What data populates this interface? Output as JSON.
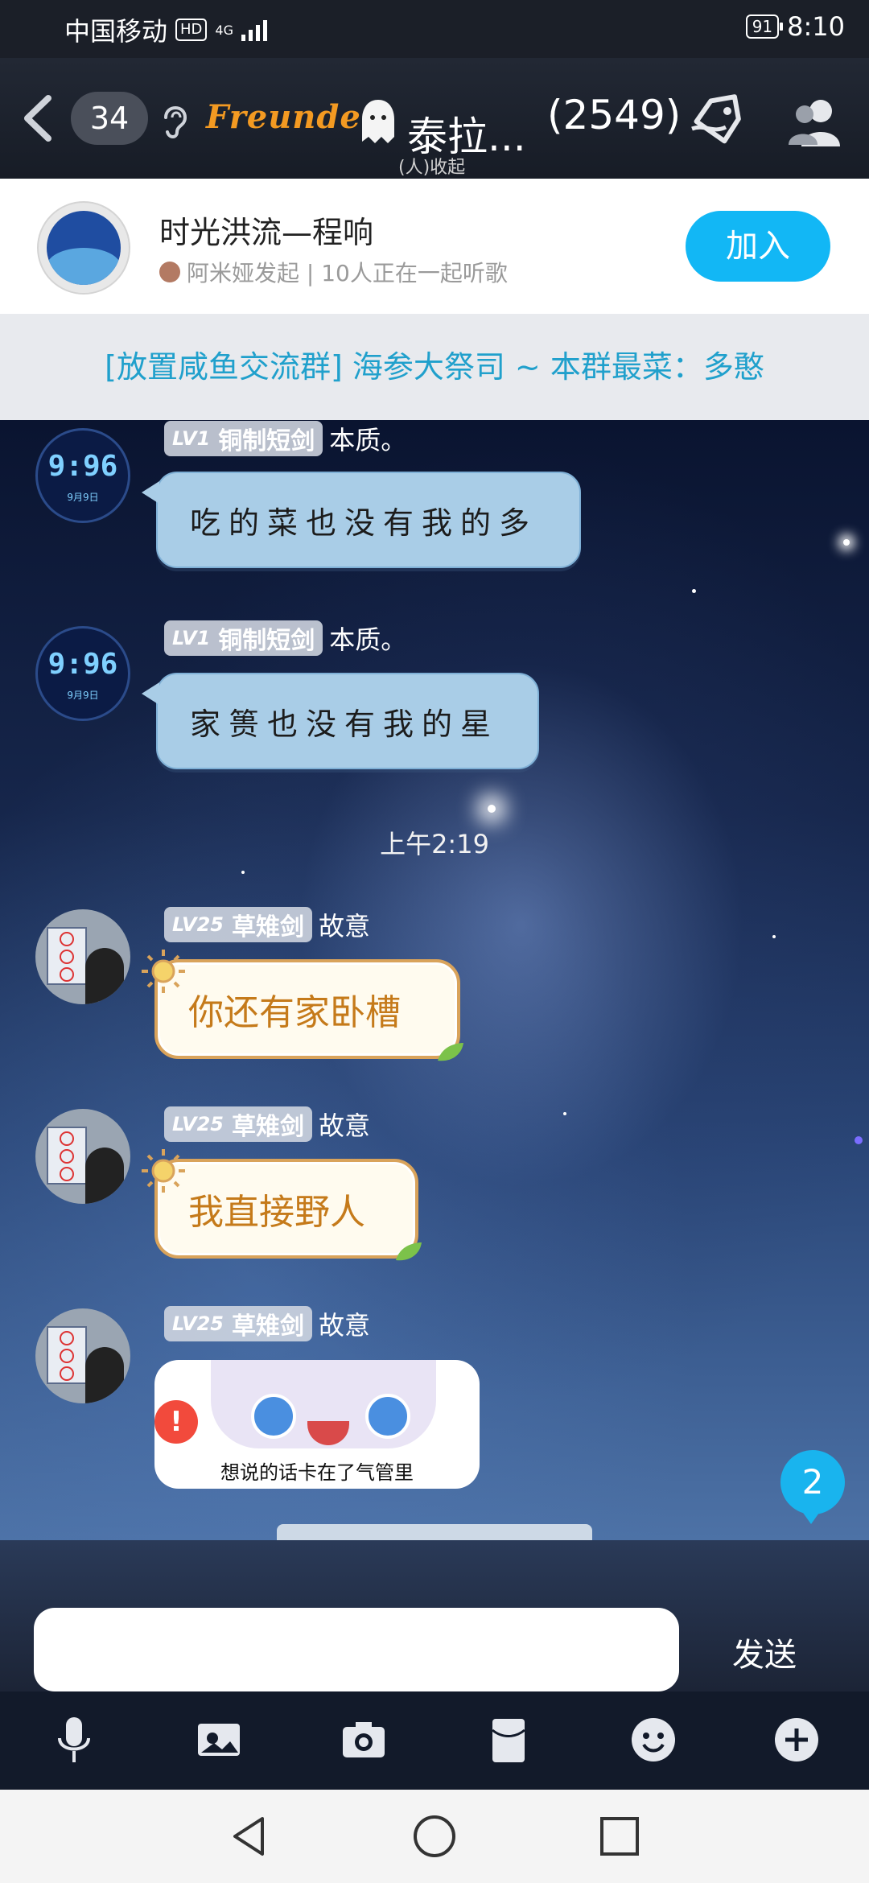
{
  "status_bar": {
    "carrier": "中国移动",
    "hd": "HD",
    "network": "4G",
    "battery": "91",
    "time": "8:10"
  },
  "header": {
    "unread_count": "34",
    "brand": "Freunde",
    "group_name": "泰拉...",
    "group_sub": "(人)收起",
    "member_count": "(2549)"
  },
  "music": {
    "title": "时光洪流—程响",
    "subtitle": "阿米娅发起 | 10人正在一起听歌",
    "join_label": "加入"
  },
  "notice": "[放置咸鱼交流群] 海参大祭司 ~ 本群最菜：多憨",
  "messages": [
    {
      "level": "LV1",
      "title": "铜制短剑",
      "nick": "本质。",
      "text": "吃的菜也没有我的多",
      "avatar": "clock-avatar"
    },
    {
      "level": "LV1",
      "title": "铜制短剑",
      "nick": "本质。",
      "text": "家篑也没有我的星",
      "avatar": "clock-avatar"
    },
    {
      "level": "LV25",
      "title": "草雉剑",
      "nick": "故意",
      "text": "你还有家卧槽",
      "avatar": "photo-avatar"
    },
    {
      "level": "LV25",
      "title": "草雉剑",
      "nick": "故意",
      "text": "我直接野人",
      "avatar": "photo-avatar"
    },
    {
      "level": "LV25",
      "title": "草雉剑",
      "nick": "故意",
      "sticker_caption": "想说的话卡在了气管里",
      "avatar": "photo-avatar"
    }
  ],
  "avatar_clock": {
    "time": "9:96",
    "line": "9月9日"
  },
  "timestamp": "上午2:19",
  "unread_bubble": "2",
  "input": {
    "value": "",
    "send_label": "发送"
  },
  "toolbar_icons": [
    "microphone-icon",
    "image-icon",
    "camera-icon",
    "red-packet-icon",
    "emoji-icon",
    "plus-icon"
  ],
  "navbar_icons": [
    "back-triangle-icon",
    "home-circle-icon",
    "recents-square-icon"
  ],
  "colors": {
    "accent": "#12b7f5",
    "notice_text": "#20a0cc",
    "sun_text": "#c57a1a"
  }
}
